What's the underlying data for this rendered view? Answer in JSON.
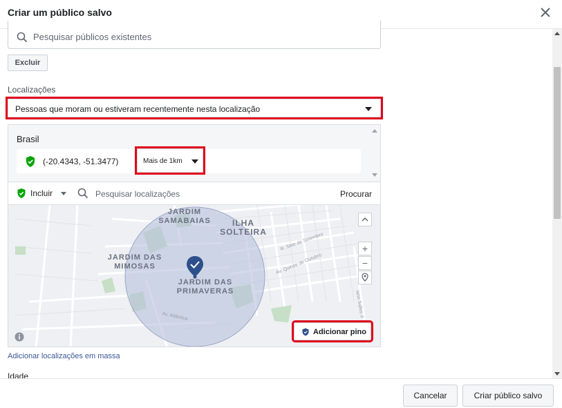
{
  "dialog": {
    "title": "Criar um público salvo"
  },
  "search": {
    "placeholder": "Pesquisar públicos existentes"
  },
  "excluir_label": "Excluir",
  "locations": {
    "label": "Localizações",
    "type_selected": "Pessoas que moram ou estiveram recentemente nesta localização",
    "country": "Brasil",
    "coordinates": "(-20.4343, -51.3477)",
    "radius_selected": "Mais de 1km"
  },
  "toolbar": {
    "include_label": "Incluir",
    "search_placeholder": "Pesquisar localizações",
    "search_button": "Procurar"
  },
  "map": {
    "labels": {
      "samambaias": "JARDIM\nSAMABAIAS",
      "ilha_solteira": "ILHA\nSOLTEIRA",
      "mimosas": "JARDIM DAS\nMIMOSAS",
      "primaveras": "JARDIM DAS\nPRIMAVERAS"
    },
    "streets": {
      "sete_setembro": "R. Sete de Setembro",
      "quinze_outubro": "Av. Quinze de Outubro",
      "atlantica": "Av. Atlântica",
      "sales": "iano Salles d"
    },
    "zoom_in": "+",
    "zoom_out": "−",
    "add_pin_label": "Adicionar pino"
  },
  "bulk_link": "Adicionar localizações em massa",
  "age_label": "Idade",
  "footer": {
    "cancel_label": "Cancelar",
    "create_label": "Criar público salvo"
  },
  "colors": {
    "highlight": "#e0001b",
    "pin_green": "#00a400",
    "pin_blue": "#2d4f8b",
    "radius_fill": "#b8c2dc",
    "link": "#385898"
  },
  "icons": {
    "close": "close-icon",
    "search": "search-icon",
    "location_pin": "location-pin-icon",
    "info": "info-icon"
  }
}
